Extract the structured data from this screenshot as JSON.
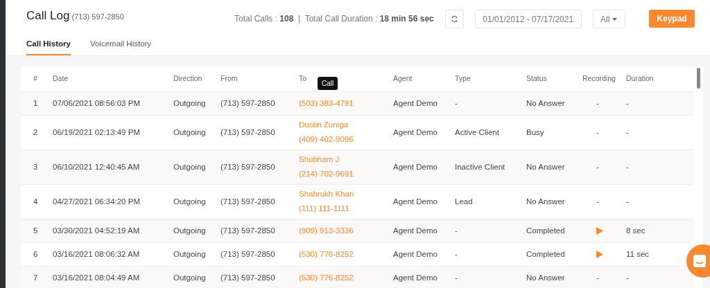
{
  "header": {
    "title": "Call Log",
    "phone": "(713) 597-2850",
    "stats": "Total Calls : **108**  |  Total Call Duration : **18 min 56 sec**",
    "date_range": "01/01/2012 - 07/17/2021",
    "filter": "All",
    "keypad_button": "Keypad"
  },
  "tabs": [
    {
      "label": "Call History",
      "selected": true
    },
    {
      "label": "Voicemail History",
      "selected": false
    }
  ],
  "table": {
    "columns": [
      "#",
      "Date",
      "Direction",
      "From",
      "To",
      "Agent",
      "Type",
      "Status",
      "Recording",
      "Duration"
    ],
    "rows": [
      {
        "num": "1",
        "date": "07/06/2021 08:56:03 PM",
        "direction": "Outgoing",
        "from": "(713) 597-2850",
        "to_name": null,
        "to_phone": "(503) 383-4791",
        "tooltip": "Call",
        "agent": "Agent Demo",
        "type": "-",
        "status": "No Answer",
        "recording": {
          "kind": "dash",
          "text": "-"
        },
        "duration": "-"
      },
      {
        "num": "2",
        "date": "06/19/2021 02:13:49 PM",
        "direction": "Outgoing",
        "from": "(713) 597-2850",
        "to_name": "Dustin Zuniga",
        "to_phone": "(409) 402-9096",
        "agent": "Agent Demo",
        "type": "Active Client",
        "status": "Busy",
        "recording": {
          "kind": "dash",
          "text": "-"
        },
        "duration": "-"
      },
      {
        "num": "3",
        "date": "06/10/2021 12:40:45 AM",
        "direction": "Outgoing",
        "from": "(713) 597-2850",
        "to_name": "Shubham J",
        "to_phone": "(214) 702-9691",
        "agent": "Agent Demo",
        "type": "Inactive Client",
        "status": "No Answer",
        "recording": {
          "kind": "dash",
          "text": "-"
        },
        "duration": "-"
      },
      {
        "num": "4",
        "date": "04/27/2021 06:34:20 PM",
        "direction": "Outgoing",
        "from": "(713) 597-2850",
        "to_name": "Shahrukh Khan",
        "to_phone": "(111) 111-1111",
        "agent": "Agent Demo",
        "type": "Lead",
        "status": "No Answer",
        "recording": {
          "kind": "dash",
          "text": "-"
        },
        "duration": "-"
      },
      {
        "num": "5",
        "date": "03/30/2021 04:52:19 AM",
        "direction": "Outgoing",
        "from": "(713) 597-2850",
        "to_name": null,
        "to_phone": "(909) 913-3336",
        "agent": "Agent Demo",
        "type": "-",
        "status": "Completed",
        "recording": {
          "kind": "play"
        },
        "duration": "8 sec"
      },
      {
        "num": "6",
        "date": "03/16/2021 08:06:32 AM",
        "direction": "Outgoing",
        "from": "(713) 597-2850",
        "to_name": null,
        "to_phone": "(530) 776-8252",
        "agent": "Agent Demo",
        "type": "-",
        "status": "Completed",
        "recording": {
          "kind": "play"
        },
        "duration": "11 sec"
      },
      {
        "num": "7",
        "date": "03/16/2021 08:04:49 AM",
        "direction": "Outgoing",
        "from": "(713) 597-2850",
        "to_name": null,
        "to_phone": "(530) 776-8252",
        "agent": "Agent Demo",
        "type": "-",
        "status": "No Answer",
        "recording": {
          "kind": "dash",
          "text": "-"
        },
        "duration": "-"
      }
    ]
  }
}
